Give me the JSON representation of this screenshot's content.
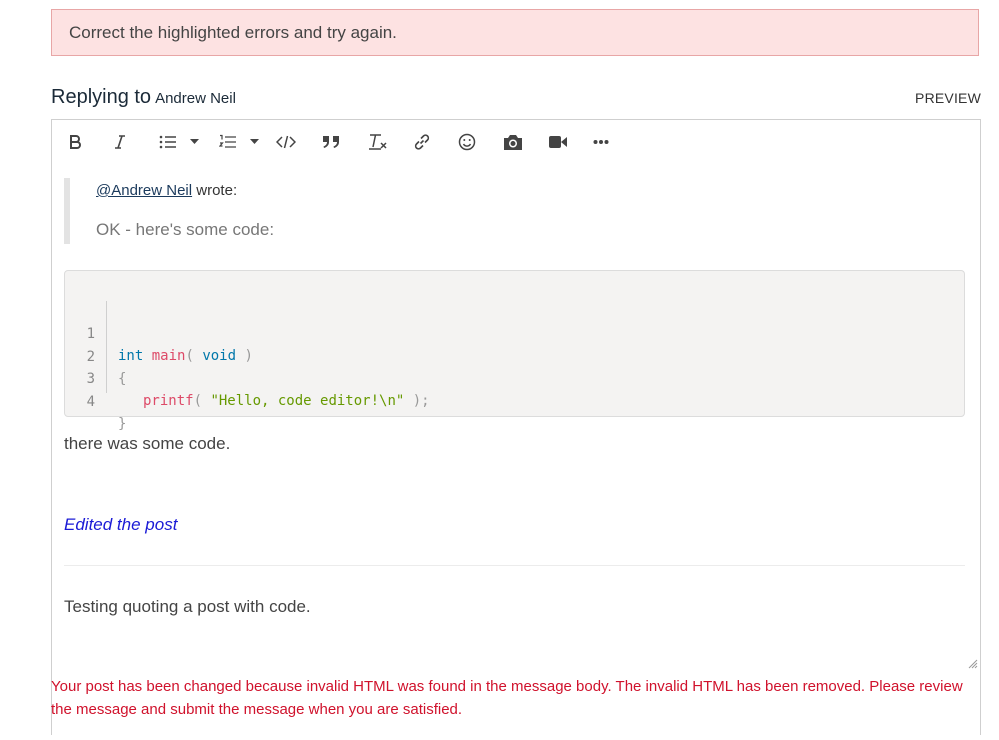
{
  "alert": {
    "text": "Correct the highlighted errors and try again."
  },
  "reply": {
    "prefix": "Replying to",
    "author": "Andrew Neil",
    "preview_label": "PREVIEW"
  },
  "toolbar": {
    "buttons": [
      "bold-icon",
      "italic-icon",
      "bulleted-list-icon",
      "numbered-list-icon",
      "code-icon",
      "quote-icon",
      "clear-format-icon",
      "link-icon",
      "emoji-icon",
      "camera-icon",
      "video-icon",
      "more-icon"
    ]
  },
  "quote": {
    "mention": "@Andrew Neil",
    "wrote": " wrote:",
    "text": "OK - here's some code:"
  },
  "code": {
    "line_numbers": [
      "1",
      "2",
      "3",
      "4"
    ],
    "line1": {
      "kw1": "int",
      "fn": "main",
      "p1": "( ",
      "kw2": "void",
      "p2": " )"
    },
    "line2": "{",
    "line3": {
      "fn": "printf",
      "p1": "( ",
      "str": "\"Hello, code editor!\\n\"",
      "p2": " );"
    },
    "line4": "}"
  },
  "body": {
    "after_code": "there was some code.",
    "edited": "Edited the post",
    "new_text": "Testing quoting a post with code."
  },
  "error": {
    "text": "Your post has been changed because invalid HTML was found in the message body. The invalid HTML has been removed. Please review the message and submit the message when you are satisfied."
  },
  "colors": {
    "error": "#d0122c",
    "alert_bg": "#fde2e2",
    "edited": "#1a1ad6"
  }
}
